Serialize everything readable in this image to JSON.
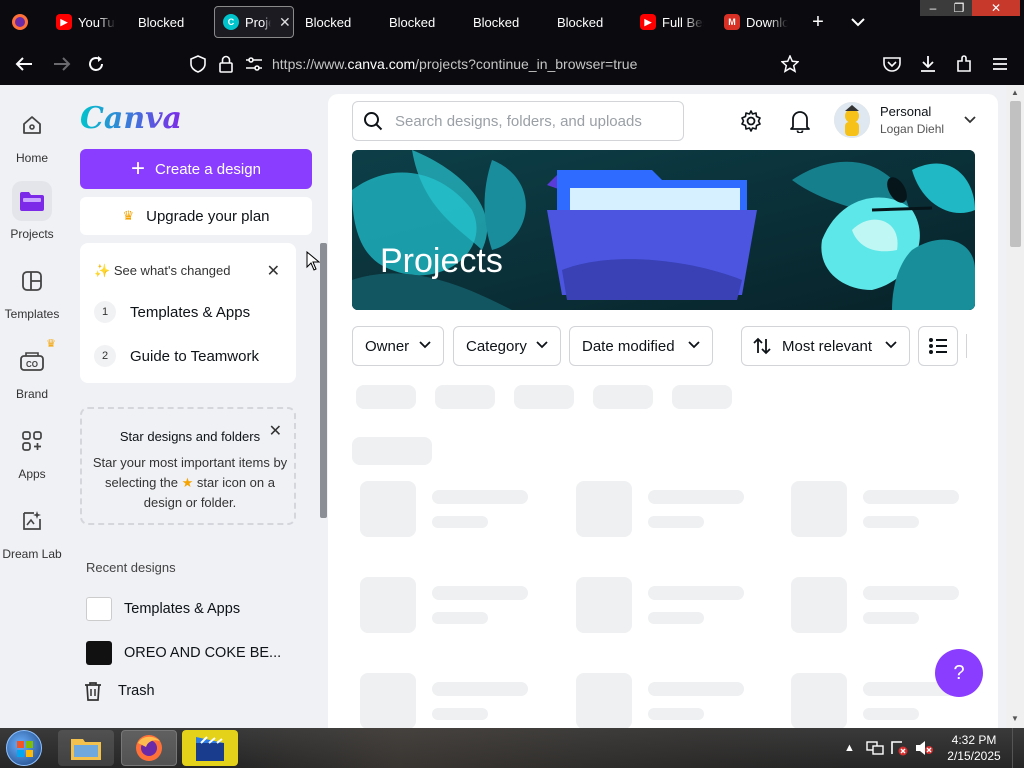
{
  "browser": {
    "tabs": [
      {
        "label": "YouTube",
        "icon": "youtube-icon",
        "color": "#ff0000"
      },
      {
        "label": "Blocked",
        "icon": "blocked-icon"
      },
      {
        "label": "Projects",
        "icon": "canva-icon",
        "color": "#00c4cc",
        "active": true
      },
      {
        "label": "Blocked",
        "icon": "blocked-icon"
      },
      {
        "label": "Blocked",
        "icon": "blocked-icon"
      },
      {
        "label": "Blocked",
        "icon": "blocked-icon"
      },
      {
        "label": "Blocked",
        "icon": "blocked-icon"
      },
      {
        "label": "Full Best",
        "icon": "youtube-icon",
        "color": "#ff0000"
      },
      {
        "label": "Download",
        "icon": "gmail-icon",
        "color": "#d93025"
      }
    ],
    "url_prefix": "https://www.",
    "url_domain": "canva.com",
    "url_path": "/projects?continue_in_browser=true"
  },
  "rail": [
    {
      "label": "Home",
      "icon": "home-icon"
    },
    {
      "label": "Projects",
      "icon": "folder-icon",
      "active": true
    },
    {
      "label": "Templates",
      "icon": "templates-icon"
    },
    {
      "label": "Brand",
      "icon": "brand-icon"
    },
    {
      "label": "Apps",
      "icon": "apps-icon"
    },
    {
      "label": "Dream Lab",
      "icon": "dream-lab-icon"
    }
  ],
  "sidebar": {
    "logo": "Canva",
    "create_label": "Create a design",
    "upgrade_label": "Upgrade your plan",
    "whats_changed": {
      "title": "See what's changed",
      "items": [
        {
          "num": "1",
          "label": "Templates & Apps"
        },
        {
          "num": "2",
          "label": "Guide to Teamwork"
        }
      ]
    },
    "star_card": {
      "title": "Star designs and folders",
      "body_before": "Star your most important items by selecting the",
      "body_after": "star icon on a design or folder."
    },
    "recent_heading": "Recent designs",
    "recent": [
      {
        "label": "Templates & Apps"
      },
      {
        "label": "OREO AND COKE BE..."
      }
    ],
    "trash_label": "Trash"
  },
  "header": {
    "search_placeholder": "Search designs, folders, and uploads",
    "account_name": "Personal",
    "account_user": "Logan Diehl"
  },
  "banner": {
    "title": "Projects"
  },
  "filters": {
    "owner": "Owner",
    "category": "Category",
    "date_modified": "Date modified",
    "sort": "Most relevant"
  },
  "help_label": "?",
  "taskbar": {
    "time": "4:32 PM",
    "date": "2/15/2025"
  },
  "colors": {
    "accent": "#8b3dff",
    "browser_bg": "#0b0b0f"
  }
}
